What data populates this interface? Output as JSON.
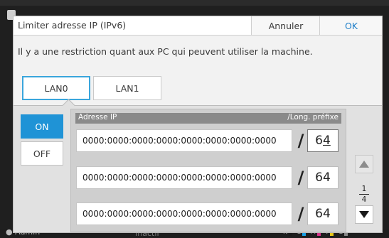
{
  "background": {
    "user": "Admin",
    "status": "Inactif",
    "toners": [
      {
        "label": "K",
        "color": "#1a1a1a"
      },
      {
        "label": "C",
        "color": "#1aa0e6"
      },
      {
        "label": "M",
        "color": "#d6338a"
      },
      {
        "label": "Y",
        "color": "#e6c51a"
      },
      {
        "label": "G",
        "color": "#888888"
      }
    ]
  },
  "dialog": {
    "title": "Limiter adresse IP (IPv6)",
    "cancel_label": "Annuler",
    "ok_label": "OK",
    "message": "Il y a une restriction quant aux PC qui peuvent utiliser la machine."
  },
  "tabs": [
    {
      "label": "LAN0",
      "selected": true
    },
    {
      "label": "LAN1",
      "selected": false
    }
  ],
  "toggle": {
    "on_label": "ON",
    "off_label": "OFF",
    "selected": "ON"
  },
  "list": {
    "header_ip": "Adresse IP",
    "header_prefix": "/Long. préfixe",
    "separator": "/",
    "rows": [
      {
        "ip": "0000:0000:0000:0000:0000:0000:0000:0000",
        "prefix_a": "6",
        "prefix_b": "4",
        "focused": true
      },
      {
        "ip": "0000:0000:0000:0000:0000:0000:0000:0000",
        "prefix": "64"
      },
      {
        "ip": "0000:0000:0000:0000:0000:0000:0000:0000",
        "prefix": "64"
      }
    ]
  },
  "pagination": {
    "current": "1",
    "total": "4"
  },
  "colors": {
    "accent": "#1f93d6",
    "ok_text": "#1f7fc9",
    "tab_selected_border": "#3aa6dc"
  }
}
